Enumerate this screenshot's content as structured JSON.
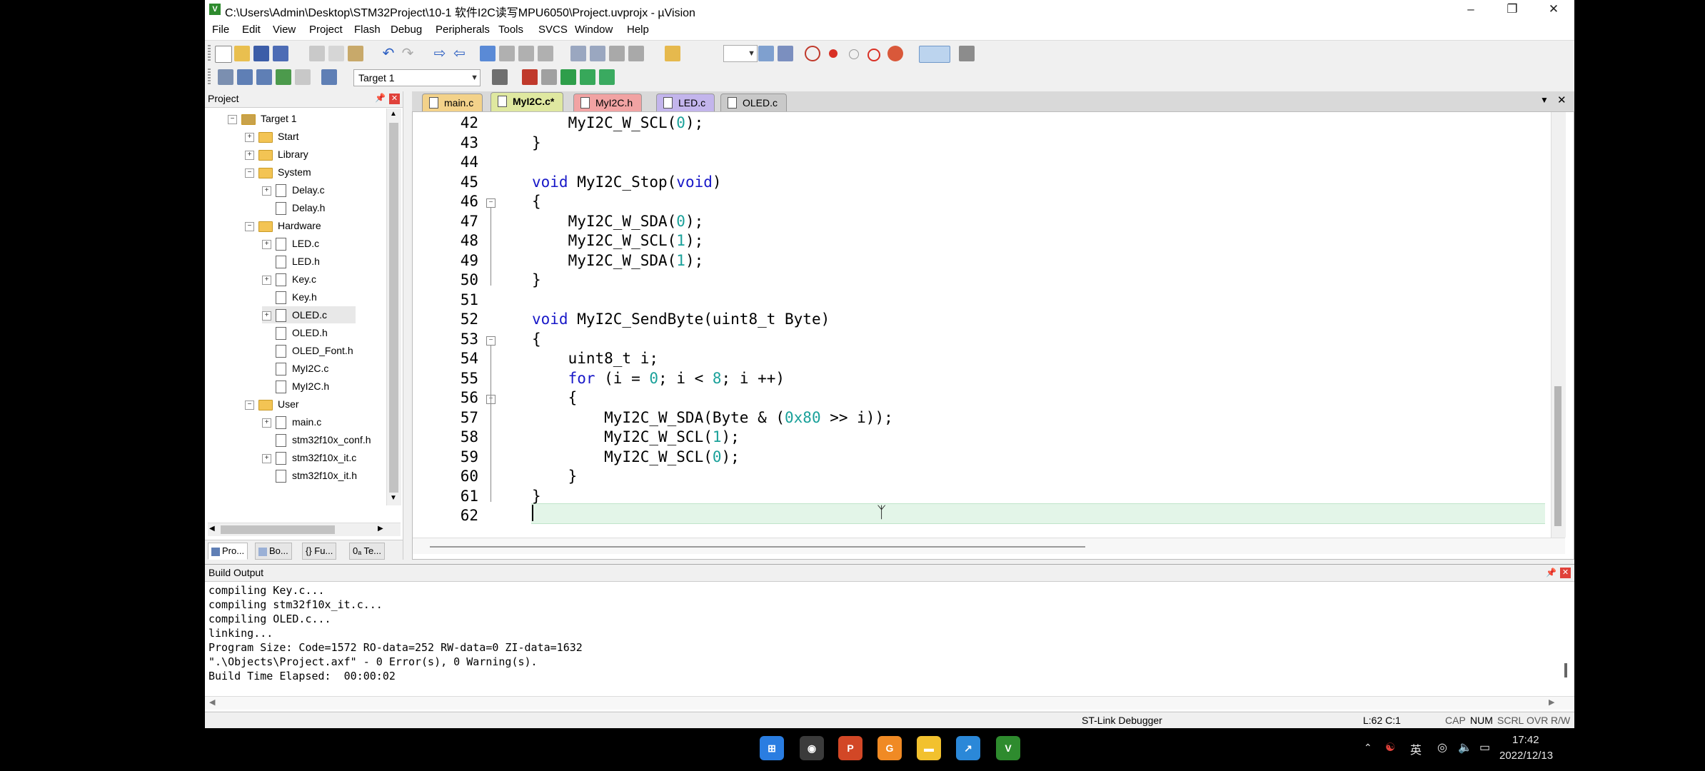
{
  "window": {
    "title": "C:\\Users\\Admin\\Desktop\\STM32Project\\10-1 软件I2C读写MPU6050\\Project.uvprojx - µVision",
    "app_icon": "V",
    "controls": [
      "minimize-icon",
      "restore-icon",
      "close-icon"
    ]
  },
  "menu": [
    "File",
    "Edit",
    "View",
    "Project",
    "Flash",
    "Debug",
    "Peripherals",
    "Tools",
    "SVCS",
    "Window",
    "Help"
  ],
  "toolbar": {
    "target_label": "Target 1"
  },
  "project": {
    "header": "Project",
    "tree": [
      {
        "label": "Target 1",
        "level": 0,
        "type": "target",
        "expander": "-"
      },
      {
        "label": "Start",
        "level": 1,
        "type": "folder",
        "expander": "+"
      },
      {
        "label": "Library",
        "level": 1,
        "type": "folder",
        "expander": "+"
      },
      {
        "label": "System",
        "level": 1,
        "type": "folder",
        "expander": "-"
      },
      {
        "label": "Delay.c",
        "level": 2,
        "type": "file",
        "expander": "+"
      },
      {
        "label": "Delay.h",
        "level": 2,
        "type": "file",
        "expander": ""
      },
      {
        "label": "Hardware",
        "level": 1,
        "type": "folder",
        "expander": "-"
      },
      {
        "label": "LED.c",
        "level": 2,
        "type": "file",
        "expander": "+"
      },
      {
        "label": "LED.h",
        "level": 2,
        "type": "file",
        "expander": ""
      },
      {
        "label": "Key.c",
        "level": 2,
        "type": "file",
        "expander": "+"
      },
      {
        "label": "Key.h",
        "level": 2,
        "type": "file",
        "expander": ""
      },
      {
        "label": "OLED.c",
        "level": 2,
        "type": "file",
        "expander": "+",
        "selected": true
      },
      {
        "label": "OLED.h",
        "level": 2,
        "type": "file",
        "expander": ""
      },
      {
        "label": "OLED_Font.h",
        "level": 2,
        "type": "file",
        "expander": ""
      },
      {
        "label": "MyI2C.c",
        "level": 2,
        "type": "file",
        "expander": ""
      },
      {
        "label": "MyI2C.h",
        "level": 2,
        "type": "file",
        "expander": ""
      },
      {
        "label": "User",
        "level": 1,
        "type": "folder",
        "expander": "-"
      },
      {
        "label": "main.c",
        "level": 2,
        "type": "file",
        "expander": "+"
      },
      {
        "label": "stm32f10x_conf.h",
        "level": 2,
        "type": "file",
        "expander": ""
      },
      {
        "label": "stm32f10x_it.c",
        "level": 2,
        "type": "file",
        "expander": "+"
      },
      {
        "label": "stm32f10x_it.h",
        "level": 2,
        "type": "file",
        "expander": ""
      }
    ],
    "tabs": [
      "Pro...",
      "Bo...",
      "{} Fu...",
      "0ₐ Te..."
    ]
  },
  "editor": {
    "tabs": [
      {
        "label": "main.c",
        "color": "#f3d28a"
      },
      {
        "label": "MyI2C.c*",
        "color": "#dfe8a0",
        "active": true
      },
      {
        "label": "MyI2C.h",
        "color": "#f1a3a3"
      },
      {
        "label": "LED.c",
        "color": "#c3b5ec"
      },
      {
        "label": "OLED.c",
        "color": "#c9c9c9"
      }
    ],
    "first_line": 42,
    "cursor_line": 62,
    "fold_markers": [
      46,
      53,
      56
    ],
    "lines": [
      [
        {
          "t": "    MyI2C_W_SCL("
        },
        {
          "t": "0",
          "c": "num"
        },
        {
          "t": ");"
        }
      ],
      [
        {
          "t": "}"
        }
      ],
      [
        {
          "t": ""
        }
      ],
      [
        {
          "t": "void",
          "c": "kw"
        },
        {
          "t": " MyI2C_Stop("
        },
        {
          "t": "void",
          "c": "kw"
        },
        {
          "t": ")"
        }
      ],
      [
        {
          "t": "{"
        }
      ],
      [
        {
          "t": "    MyI2C_W_SDA("
        },
        {
          "t": "0",
          "c": "num"
        },
        {
          "t": ");"
        }
      ],
      [
        {
          "t": "    MyI2C_W_SCL("
        },
        {
          "t": "1",
          "c": "num"
        },
        {
          "t": ");"
        }
      ],
      [
        {
          "t": "    MyI2C_W_SDA("
        },
        {
          "t": "1",
          "c": "num"
        },
        {
          "t": ");"
        }
      ],
      [
        {
          "t": "}"
        }
      ],
      [
        {
          "t": ""
        }
      ],
      [
        {
          "t": "void",
          "c": "kw"
        },
        {
          "t": " MyI2C_SendByte(uint8_t Byte)"
        }
      ],
      [
        {
          "t": "{"
        }
      ],
      [
        {
          "t": "    uint8_t i;"
        }
      ],
      [
        {
          "t": "    "
        },
        {
          "t": "for",
          "c": "kw"
        },
        {
          "t": " (i = "
        },
        {
          "t": "0",
          "c": "num"
        },
        {
          "t": "; i < "
        },
        {
          "t": "8",
          "c": "num"
        },
        {
          "t": "; i ++)"
        }
      ],
      [
        {
          "t": "    {"
        }
      ],
      [
        {
          "t": "        MyI2C_W_SDA(Byte & ("
        },
        {
          "t": "0x80",
          "c": "num"
        },
        {
          "t": " >> i));"
        }
      ],
      [
        {
          "t": "        MyI2C_W_SCL("
        },
        {
          "t": "1",
          "c": "num"
        },
        {
          "t": ");"
        }
      ],
      [
        {
          "t": "        MyI2C_W_SCL("
        },
        {
          "t": "0",
          "c": "num"
        },
        {
          "t": ");"
        }
      ],
      [
        {
          "t": "    }"
        }
      ],
      [
        {
          "t": "}"
        }
      ],
      [
        {
          "t": ""
        }
      ]
    ]
  },
  "build_output": {
    "header": "Build Output",
    "lines": [
      "compiling Key.c...",
      "compiling stm32f10x_it.c...",
      "compiling OLED.c...",
      "linking...",
      "Program Size: Code=1572 RO-data=252 RW-data=0 ZI-data=1632",
      "\".\\Objects\\Project.axf\" - 0 Error(s), 0 Warning(s).",
      "Build Time Elapsed:  00:00:02"
    ]
  },
  "status": {
    "debugger": "ST-Link Debugger",
    "position": "L:62 C:1",
    "indicators": [
      "CAP",
      "NUM",
      "SCRL",
      "OVR",
      "R/W"
    ]
  },
  "taskbar": {
    "apps": [
      {
        "name": "start-icon",
        "color": "#2a7de1",
        "glyph": "⊞"
      },
      {
        "name": "camera-app-icon",
        "color": "#3b3b3b",
        "glyph": "◉"
      },
      {
        "name": "powerpoint-icon",
        "color": "#d24726",
        "glyph": "P"
      },
      {
        "name": "office-app-icon",
        "color": "#f08a24",
        "glyph": "G"
      },
      {
        "name": "file-explorer-icon",
        "color": "#f2c12e",
        "glyph": "▬"
      },
      {
        "name": "maps-app-icon",
        "color": "#2b88d8",
        "glyph": "↗"
      },
      {
        "name": "keil-uvision-icon",
        "color": "#2e8b2e",
        "glyph": "V"
      }
    ],
    "ime": "英",
    "time": "17:42",
    "date": "2022/12/13"
  }
}
